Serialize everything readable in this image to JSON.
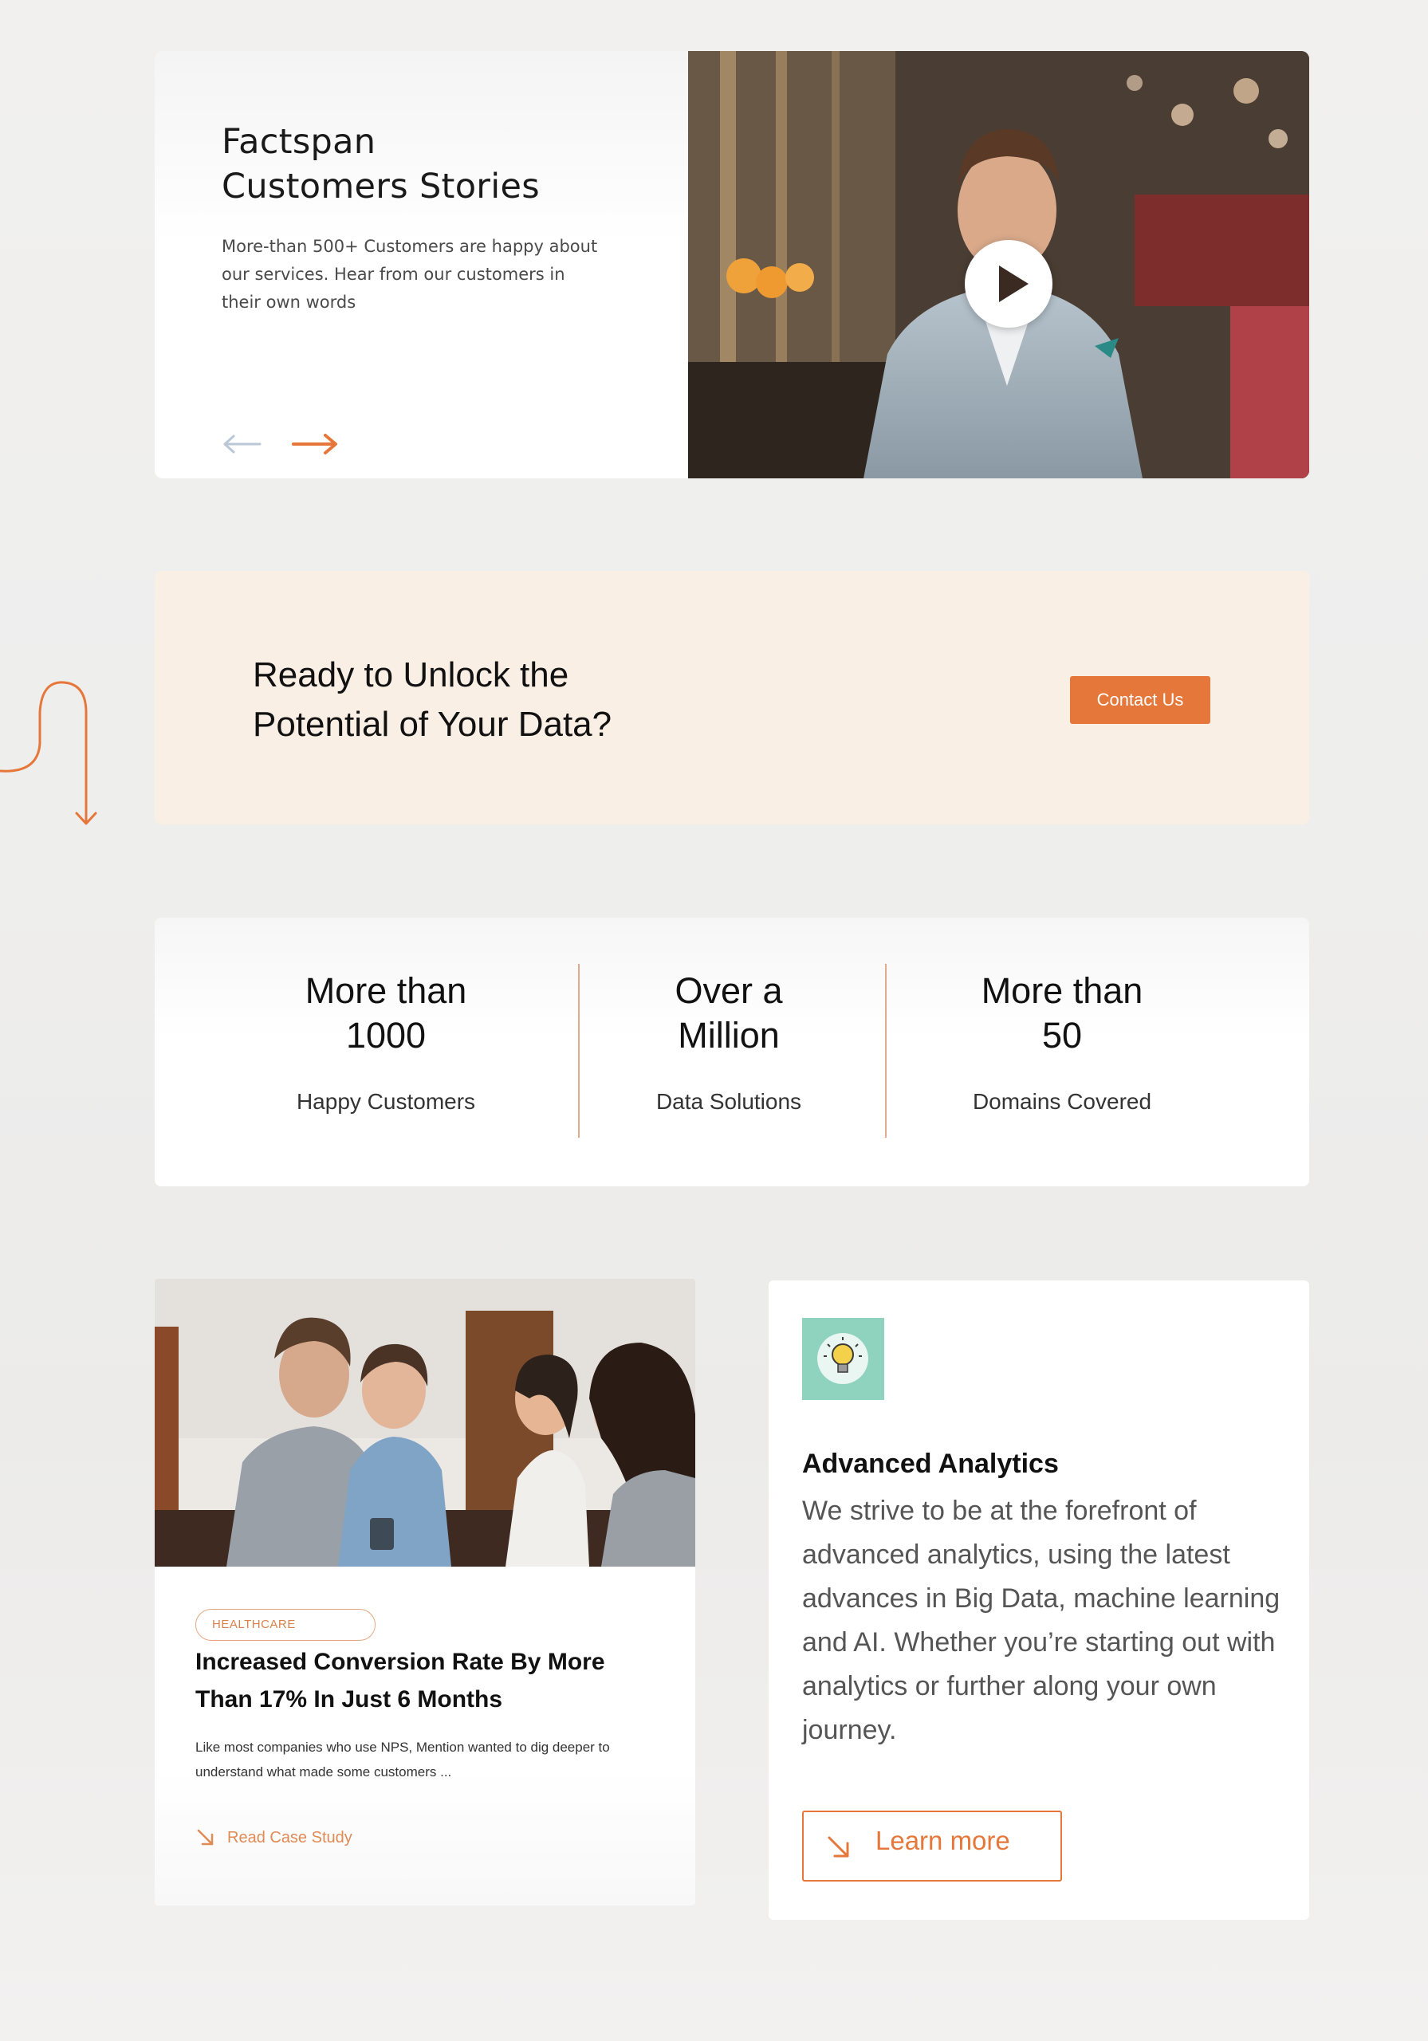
{
  "stories": {
    "title_line1": "Factspan",
    "title_line2": "Customers Stories",
    "description": "More-than 500+ Customers are happy about our services. Hear from our customers in their own words",
    "prev_icon": "arrow-left-icon",
    "next_icon": "arrow-right-icon",
    "play_icon": "play-icon"
  },
  "cta": {
    "title_line1": "Ready to Unlock the",
    "title_line2": "Potential of Your Data?",
    "button_label": "Contact Us",
    "decor_icon": "squiggle-arrow-down-icon"
  },
  "stats": [
    {
      "value_line1": "More than",
      "value_line2": "1000",
      "label": "Happy Customers"
    },
    {
      "value_line1": "Over a",
      "value_line2": "Million",
      "label": "Data Solutions"
    },
    {
      "value_line1": "More than",
      "value_line2": "50",
      "label": "Domains Covered"
    }
  ],
  "case_study": {
    "tag": "HEALTHCARE",
    "title": "Increased Conversion Rate By More Than 17% In Just 6 Months",
    "description": "Like most companies who use NPS, Mention wanted to dig deeper to understand what made some customers ...",
    "link_label": "Read Case Study",
    "link_icon": "arrow-down-right-icon"
  },
  "analytics": {
    "icon": "lightbulb-icon",
    "title": "Advanced Analytics",
    "description": "We strive to be at the forefront of advanced analytics, using the latest advances in Big Data, machine learning and AI. Whether you’re starting out with analytics or further along your own journey.",
    "button_label": "Learn more",
    "button_icon": "arrow-down-right-icon"
  },
  "colors": {
    "accent": "#e6773a",
    "cta_bg": "#faefe5",
    "divider": "#e2a98a",
    "icon_bg": "#8fd3be"
  }
}
